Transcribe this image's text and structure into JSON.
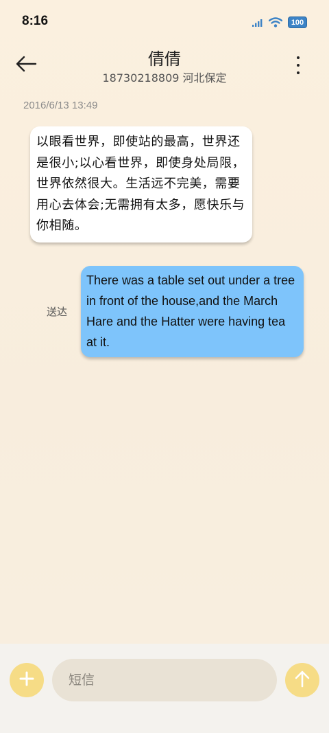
{
  "status_bar": {
    "time": "8:16",
    "battery": "100",
    "icons": [
      "signal-icon",
      "wifi-icon",
      "battery-icon"
    ]
  },
  "header": {
    "contact_name": "倩倩",
    "contact_info": "18730218809 河北保定",
    "back_icon": "arrow-left-icon",
    "more_icon": "more-vertical-icon"
  },
  "conversation": {
    "timestamp": "2016/6/13 13:49",
    "messages": [
      {
        "direction": "received",
        "text": "以眼看世界，即使站的最高，世界还是很小;以心看世界，即使身处局限，世界依然很大。生活远不完美，需要用心去体会;无需拥有太多，愿快乐与你相随。"
      },
      {
        "direction": "sent",
        "status": "送达",
        "text": "There was a table set out under a tree in front of the house,and the March Hare and the Hatter were having tea at it."
      }
    ]
  },
  "input_bar": {
    "placeholder": "短信",
    "add_icon": "plus-icon",
    "send_icon": "arrow-up-icon"
  },
  "colors": {
    "background": "#fbf0df",
    "received_bubble": "#ffffff",
    "sent_bubble": "#7ec4fb",
    "accent_button": "#f6dc86",
    "input_background": "#e9e2d5"
  }
}
